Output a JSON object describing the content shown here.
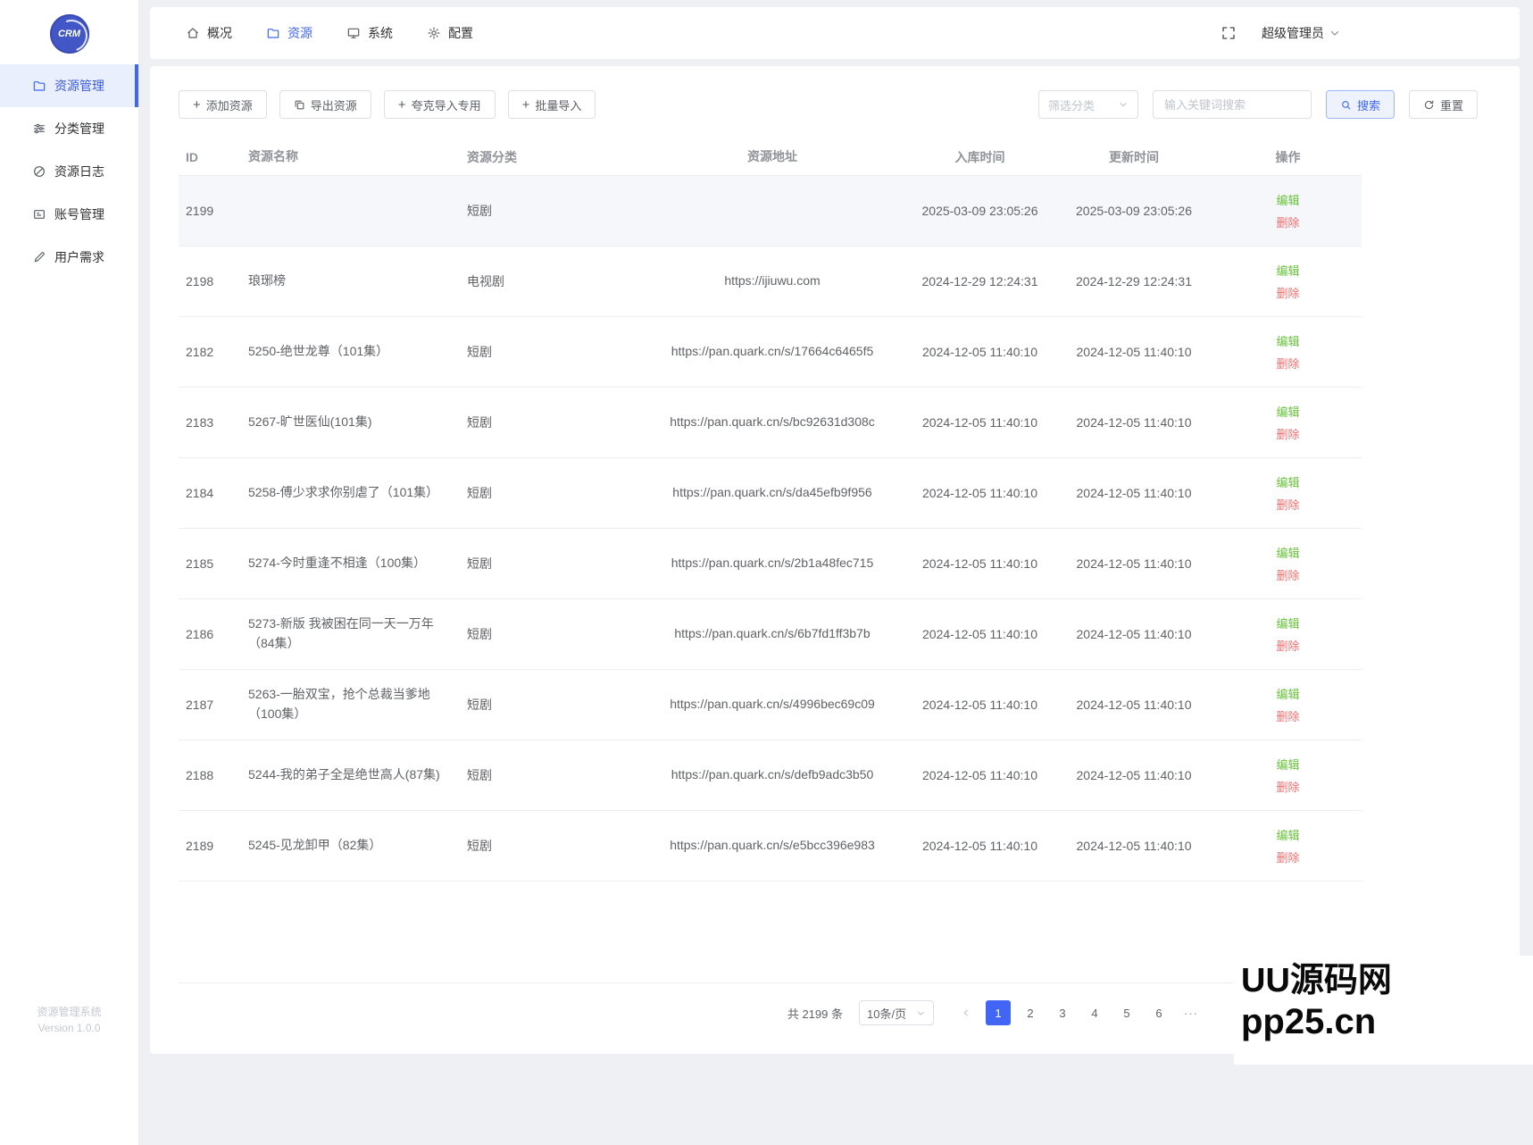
{
  "app": {
    "logo_text": "CRM",
    "sidebar_footer_title": "资源管理系统",
    "sidebar_footer_version": "Version 1.0.0"
  },
  "colors": {
    "primary": "#4166f5",
    "edit_link": "#67c23a",
    "delete_link": "#f56c6c",
    "active_row_bg": "#f5f7fa"
  },
  "topnav": {
    "items": [
      {
        "label": "概况",
        "icon": "home-icon",
        "active": false
      },
      {
        "label": "资源",
        "icon": "folder-icon",
        "active": true
      },
      {
        "label": "系统",
        "icon": "monitor-icon",
        "active": false
      },
      {
        "label": "配置",
        "icon": "gear-icon",
        "active": false
      }
    ],
    "user_name": "超级管理员"
  },
  "sidebar": {
    "items": [
      {
        "label": "资源管理",
        "icon": "folder-icon",
        "active": true
      },
      {
        "label": "分类管理",
        "icon": "sliders-icon",
        "active": false
      },
      {
        "label": "资源日志",
        "icon": "log-icon",
        "active": false
      },
      {
        "label": "账号管理",
        "icon": "id-card-icon",
        "active": false
      },
      {
        "label": "用户需求",
        "icon": "pen-icon",
        "active": false
      }
    ]
  },
  "toolbar": {
    "add_label": "添加资源",
    "export_label": "导出资源",
    "quark_import_label": "夸克导入专用",
    "batch_import_label": "批量导入",
    "filter_placeholder": "筛选分类",
    "keyword_placeholder": "输入关键词搜索",
    "search_label": "搜索",
    "reset_label": "重置"
  },
  "table": {
    "headers": [
      "ID",
      "资源名称",
      "资源分类",
      "资源地址",
      "入库时间",
      "更新时间",
      "操作"
    ],
    "edit_label": "编辑",
    "delete_label": "删除",
    "rows": [
      {
        "id": "2199",
        "name": "",
        "category": "短剧",
        "url": "",
        "created": "2025-03-09 23:05:26",
        "updated": "2025-03-09 23:05:26",
        "highlighted": true
      },
      {
        "id": "2198",
        "name": "琅琊榜",
        "category": "电视剧",
        "url": "https://ijiuwu.com",
        "created": "2024-12-29 12:24:31",
        "updated": "2024-12-29 12:24:31",
        "highlighted": false
      },
      {
        "id": "2182",
        "name": "5250-绝世龙尊（101集）",
        "category": "短剧",
        "url": "https://pan.quark.cn/s/17664c6465f5",
        "created": "2024-12-05 11:40:10",
        "updated": "2024-12-05 11:40:10",
        "highlighted": false
      },
      {
        "id": "2183",
        "name": "5267-旷世医仙(101集)",
        "category": "短剧",
        "url": "https://pan.quark.cn/s/bc92631d308c",
        "created": "2024-12-05 11:40:10",
        "updated": "2024-12-05 11:40:10",
        "highlighted": false
      },
      {
        "id": "2184",
        "name": "5258-傅少求求你别虐了（101集）",
        "category": "短剧",
        "url": "https://pan.quark.cn/s/da45efb9f956",
        "created": "2024-12-05 11:40:10",
        "updated": "2024-12-05 11:40:10",
        "highlighted": false
      },
      {
        "id": "2185",
        "name": "5274-今时重逢不相逢（100集）",
        "category": "短剧",
        "url": "https://pan.quark.cn/s/2b1a48fec715",
        "created": "2024-12-05 11:40:10",
        "updated": "2024-12-05 11:40:10",
        "highlighted": false
      },
      {
        "id": "2186",
        "name": "5273-新版 我被困在同一天一万年（84集）",
        "category": "短剧",
        "url": "https://pan.quark.cn/s/6b7fd1ff3b7b",
        "created": "2024-12-05 11:40:10",
        "updated": "2024-12-05 11:40:10",
        "highlighted": false
      },
      {
        "id": "2187",
        "name": "5263-一胎双宝，抢个总裁当爹地（100集）",
        "category": "短剧",
        "url": "https://pan.quark.cn/s/4996bec69c09",
        "created": "2024-12-05 11:40:10",
        "updated": "2024-12-05 11:40:10",
        "highlighted": false
      },
      {
        "id": "2188",
        "name": "5244-我的弟子全是绝世高人(87集)",
        "category": "短剧",
        "url": "https://pan.quark.cn/s/defb9adc3b50",
        "created": "2024-12-05 11:40:10",
        "updated": "2024-12-05 11:40:10",
        "highlighted": false
      },
      {
        "id": "2189",
        "name": "5245-见龙卸甲（82集）",
        "category": "短剧",
        "url": "https://pan.quark.cn/s/e5bcc396e983",
        "created": "2024-12-05 11:40:10",
        "updated": "2024-12-05 11:40:10",
        "highlighted": false
      }
    ]
  },
  "pagination": {
    "total_label": "共 2199 条",
    "page_size_label": "10条/页",
    "pages": [
      {
        "label": "1",
        "active": true
      },
      {
        "label": "2",
        "active": false
      },
      {
        "label": "3",
        "active": false
      },
      {
        "label": "4",
        "active": false
      },
      {
        "label": "5",
        "active": false
      },
      {
        "label": "6",
        "active": false
      }
    ],
    "more_label": "···"
  },
  "watermark": {
    "line1": "UU源码网",
    "line2": "pp25.cn"
  }
}
